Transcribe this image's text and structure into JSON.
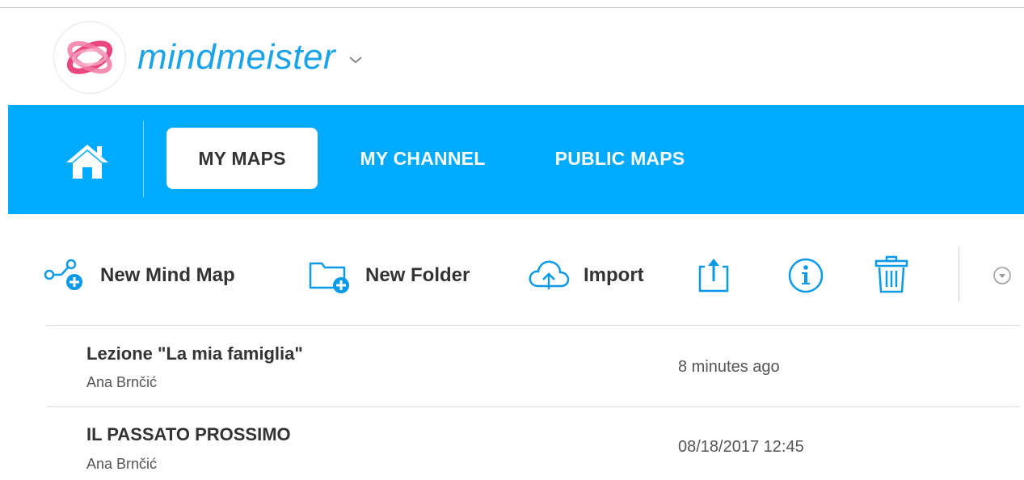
{
  "brand": {
    "logo_text": "mindmeister",
    "accent_color": "#00aaff",
    "logo_colors": [
      "#e8467c",
      "#f27aa6"
    ]
  },
  "nav": {
    "home_icon": "home-icon",
    "tabs": [
      {
        "label": "MY MAPS",
        "active": true
      },
      {
        "label": "MY CHANNEL",
        "active": false
      },
      {
        "label": "PUBLIC MAPS",
        "active": false
      }
    ]
  },
  "toolbar": {
    "new_mind_map": "New Mind Map",
    "new_folder": "New Folder",
    "import": "Import",
    "icons": [
      "new-mind-map-icon",
      "new-folder-icon",
      "import-cloud-icon",
      "share-icon",
      "info-icon",
      "trash-icon",
      "more-dropdown-icon"
    ]
  },
  "maps": [
    {
      "title": "Lezione \"La mia famiglia\"",
      "owner": "Ana Brnčić",
      "modified": "8 minutes ago"
    },
    {
      "title": "IL PASSATO PROSSIMO",
      "owner": "Ana Brnčić",
      "modified": "08/18/2017 12:45"
    }
  ]
}
